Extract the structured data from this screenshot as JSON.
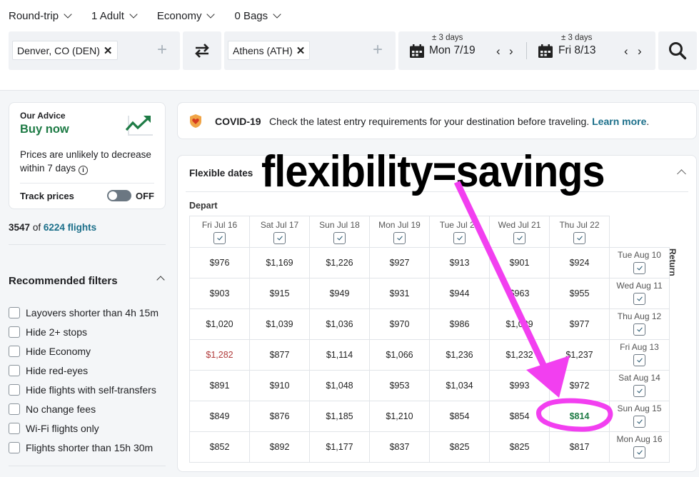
{
  "search_options": {
    "trip_type": "Round-trip",
    "passengers": "1 Adult",
    "cabin": "Economy",
    "bags": "0 Bags"
  },
  "search": {
    "origin": "Denver, CO (DEN)",
    "destination": "Athens (ATH)",
    "depart": {
      "flex": "± 3 days",
      "date": "Mon 7/19"
    },
    "return": {
      "flex": "± 3 days",
      "date": "Fri 8/13"
    },
    "remove_glyph": "✕",
    "add_glyph": "+",
    "prev_glyph": "‹",
    "next_glyph": "›"
  },
  "advice": {
    "label": "Our Advice",
    "verdict": "Buy now",
    "description": "Prices are unlikely to decrease within 7 days",
    "info_glyph": "i",
    "track_label": "Track prices",
    "track_state": "OFF",
    "colors": {
      "verdict": "#1e7b45"
    }
  },
  "results": {
    "shown": "3547",
    "of": "of",
    "total": "6224 flights"
  },
  "filters": {
    "title": "Recommended filters",
    "items": [
      {
        "label": "Layovers shorter than 4h 15m",
        "checked": false
      },
      {
        "label": "Hide 2+ stops",
        "checked": false
      },
      {
        "label": "Hide Economy",
        "checked": false
      },
      {
        "label": "Hide red-eyes",
        "checked": false
      },
      {
        "label": "Hide flights with self-transfers",
        "checked": false
      },
      {
        "label": "No change fees",
        "checked": false
      },
      {
        "label": "Wi-Fi flights only",
        "checked": false
      },
      {
        "label": "Flights shorter than 15h 30m",
        "checked": false
      }
    ]
  },
  "covid": {
    "title": "COVID-19",
    "message": "Check the latest entry requirements for your destination before traveling.",
    "link": "Learn more",
    "trailing": "."
  },
  "flexible_dates": {
    "title": "Flexible dates",
    "depart_label": "Depart",
    "return_label": "Return",
    "depart_dates": [
      "Fri Jul 16",
      "Sat Jul 17",
      "Sun Jul 18",
      "Mon Jul 19",
      "Tue Jul 20",
      "Wed Jul 21",
      "Thu Jul 22"
    ],
    "return_dates": [
      "Tue Aug 10",
      "Wed Aug 11",
      "Thu Aug 12",
      "Fri Aug 13",
      "Sat Aug 14",
      "Sun Aug 15",
      "Mon Aug 16"
    ],
    "prices": [
      [
        "$976",
        "$1,169",
        "$1,226",
        "$927",
        "$913",
        "$901",
        "$924"
      ],
      [
        "$903",
        "$915",
        "$949",
        "$931",
        "$944",
        "$963",
        "$955"
      ],
      [
        "$1,020",
        "$1,039",
        "$1,036",
        "$970",
        "$986",
        "$1,029",
        "$977"
      ],
      [
        "$1,282",
        "$877",
        "$1,114",
        "$1,066",
        "$1,236",
        "$1,232",
        "$1,237"
      ],
      [
        "$891",
        "$910",
        "$1,048",
        "$953",
        "$1,034",
        "$993",
        "$972"
      ],
      [
        "$849",
        "$876",
        "$1,185",
        "$1,210",
        "$854",
        "$854",
        "$814"
      ],
      [
        "$852",
        "$892",
        "$1,177",
        "$837",
        "$825",
        "$825",
        "$817"
      ]
    ],
    "highest": {
      "row": 3,
      "col": 0
    },
    "lowest": {
      "row": 5,
      "col": 6
    },
    "colors": {
      "highest": "#b03a3a",
      "lowest": "#1e7b45"
    }
  },
  "annotation": {
    "text": "flexibility=savings",
    "color": "#f23ff0"
  }
}
